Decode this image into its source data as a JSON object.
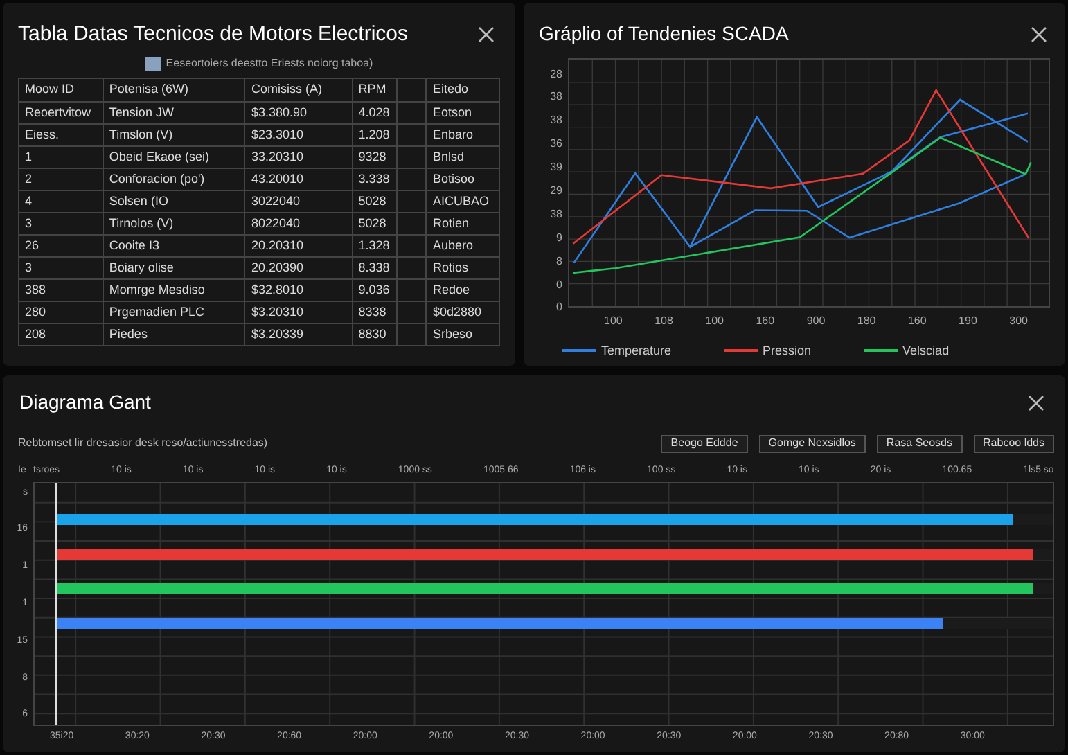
{
  "table_panel": {
    "title": "Tabla Datas Tecnicos de Motors Electricos",
    "legend": "Eeseortoiers deestto Eriests noiorg taboa)",
    "columns": [
      {
        "label": "Moow ID"
      },
      {
        "label": "Potenisa (6W)"
      },
      {
        "label": "Comisiss (A)"
      },
      {
        "label": "RPM"
      },
      {
        "kind": "blank"
      },
      {
        "label": "Eitedo"
      }
    ],
    "rows": [
      [
        "Reoertvitow",
        "Tension JW",
        "$3.380.90",
        "4.028",
        "Eotson"
      ],
      [
        "Eiess.",
        "Timslon (V)",
        "$23.3010",
        "1.208",
        "Enbaro"
      ],
      [
        "1",
        "Obeid Ekaoe (sei)",
        "33.20310",
        "9328",
        "Bnlsd"
      ],
      [
        "2",
        "Conforacion (po')",
        "43.20010",
        "3.338",
        "Botisoo"
      ],
      [
        "4",
        "Solsen (IO",
        "3022040",
        "5028",
        "AICUBAO"
      ],
      [
        "3",
        "Tirnolos (V)",
        "8022040",
        "5028",
        "Rotien"
      ],
      [
        "26",
        "Cooite I3",
        "20.20310",
        "1.328",
        "Aubero"
      ],
      [
        "3",
        "Boiary olise",
        "20.20390",
        "8.338",
        "Rotios"
      ],
      [
        "388",
        "Momrge Mesdiso",
        "$32.8010",
        "9.036",
        "Redoe"
      ],
      [
        "280",
        "Prgemadien PLC",
        "$3.20310",
        "8338",
        "$0d2880"
      ],
      [
        "208",
        "Piedes",
        "$3.20339",
        "8830",
        "Srbeso"
      ]
    ]
  },
  "chart_panel": {
    "title": "Gráplio of Tendenies SCADA",
    "y_tick_labels": [
      "28",
      "38",
      "38",
      "36",
      "39",
      "29",
      "38",
      "9",
      "8",
      "0",
      "0"
    ],
    "x_tick_labels": [
      "100",
      "108",
      "100",
      "160",
      "900",
      "180",
      "160",
      "190",
      "300"
    ],
    "legend": [
      {
        "label": "Temperature",
        "color": "#2f7fe0"
      },
      {
        "label": "Pression",
        "color": "#e53935"
      },
      {
        "label": "Velsciad",
        "color": "#22c55e"
      }
    ]
  },
  "gantt_panel": {
    "title": "Diagrama Gant",
    "subtitle": "Rebtomset lir dresasior desk reso/actiunesstredas)",
    "buttons": [
      "Beogo Eddde",
      "Gomge Nexsidlos",
      "Rasa Seosds",
      "Rabcoo ldds"
    ],
    "corner_label": "Ie",
    "header_ticks": [
      "tsroes",
      "10 is",
      "10 is",
      "10 is",
      "10 is",
      "1000 ss",
      "1005 66",
      "106 is",
      "100 ss",
      "10 is",
      "10 is",
      "20 is",
      "100.65",
      "1ls5 so"
    ],
    "row_labels": [
      "s",
      "16",
      "1",
      "1",
      "15",
      "8",
      "6"
    ],
    "bars": [
      {
        "color": "#1aa3e8",
        "level": 0.96
      },
      {
        "color": "#e53935",
        "level": 0.98
      },
      {
        "color": "#22c55e",
        "level": 0.98
      },
      {
        "color": "#3b82f6",
        "level": 0.89
      }
    ],
    "time_ticks": [
      "35i20",
      "30:20",
      "20:30",
      "20:60",
      "20:00",
      "20:00",
      "20:30",
      "20:00",
      "20:30",
      "20:00",
      "20:30",
      "20:80",
      "30:00"
    ]
  }
}
